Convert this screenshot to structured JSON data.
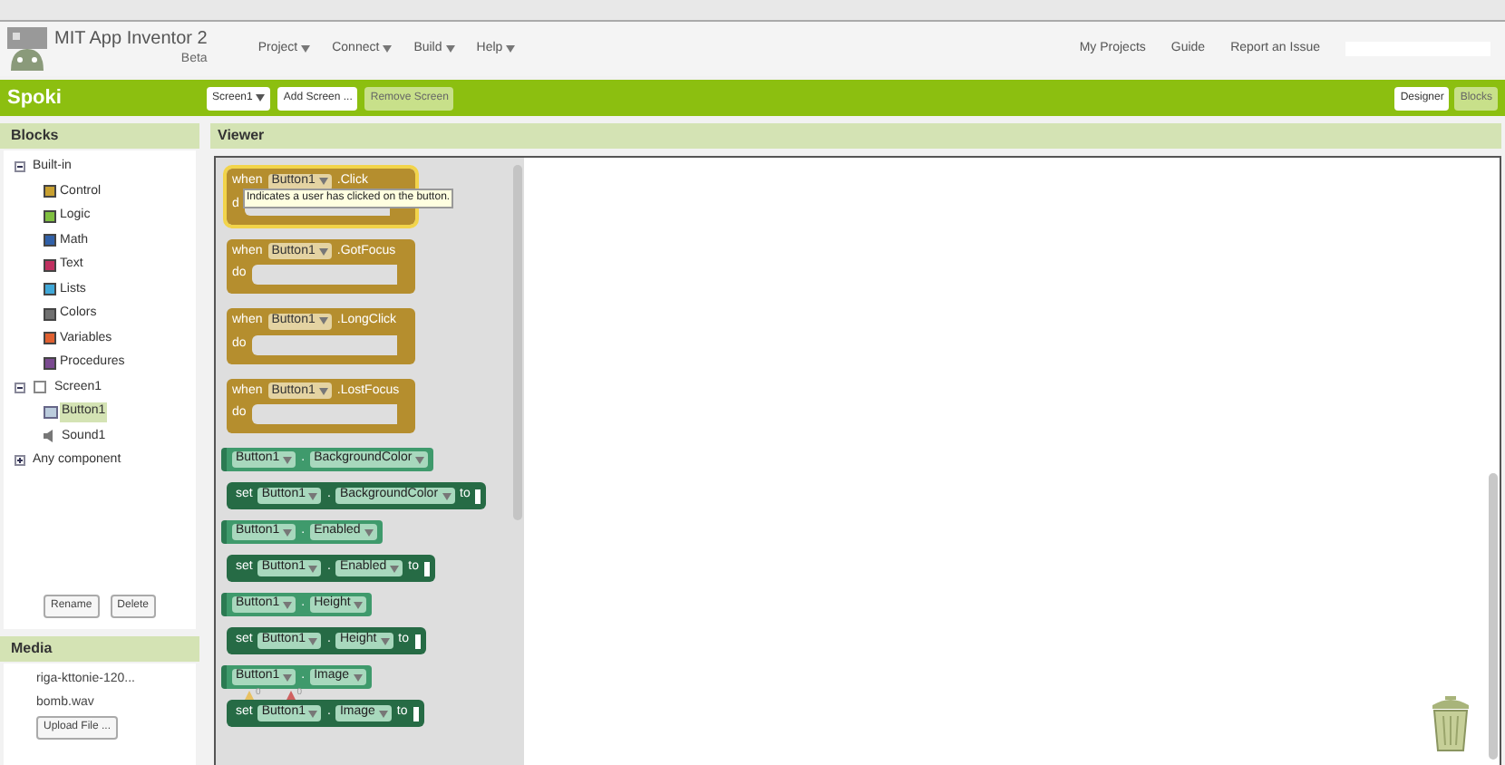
{
  "header": {
    "app_title": "MIT App Inventor 2",
    "subtitle": "Beta",
    "menus": [
      "Project",
      "Connect",
      "Build",
      "Help"
    ],
    "links": [
      "My Projects",
      "Guide",
      "Report an Issue"
    ]
  },
  "toolbar": {
    "project_name": "Spoki",
    "screen": "Screen1",
    "buttons": [
      {
        "label": "Add Screen ...",
        "disabled": false
      },
      {
        "label": "Remove Screen",
        "disabled": true
      }
    ],
    "views": [
      {
        "label": "Designer",
        "selected": false
      },
      {
        "label": "Blocks",
        "selected": true
      }
    ]
  },
  "blocks_panel": {
    "title": "Blocks",
    "tree": [
      {
        "label": "Built-in",
        "expanded": true,
        "selected": false,
        "children": [
          {
            "label": "Control",
            "color": "#c8a030",
            "selected": false
          },
          {
            "label": "Logic",
            "color": "#80c040",
            "selected": false
          },
          {
            "label": "Math",
            "color": "#3060a8",
            "selected": false
          },
          {
            "label": "Text",
            "color": "#c03060",
            "selected": false
          },
          {
            "label": "Lists",
            "color": "#40a8d8",
            "selected": false
          },
          {
            "label": "Colors",
            "color": "#707070",
            "selected": false
          },
          {
            "label": "Variables",
            "color": "#e06030",
            "selected": false
          },
          {
            "label": "Procedures",
            "color": "#7a4a90",
            "selected": false
          }
        ]
      },
      {
        "label": "Screen1",
        "expanded": true,
        "selected": false,
        "children": [
          {
            "label": "Button1",
            "kind": "button",
            "selected": true
          },
          {
            "label": "Sound1",
            "kind": "sound",
            "selected": false
          }
        ]
      },
      {
        "label": "Any component",
        "expanded": false,
        "selected": false
      }
    ],
    "buttons": [
      "Rename",
      "Delete"
    ]
  },
  "media": {
    "title": "Media",
    "files": [
      "riga-kttonie-120...",
      "bomb.wav"
    ],
    "upload": "Upload File ..."
  },
  "viewer": {
    "title": "Viewer",
    "blocks": [
      {
        "kind": "event",
        "when": "when",
        "component": "Button1",
        "event": ".Click",
        "do": "d",
        "selected": true,
        "tooltip": "Indicates a user has clicked on the button."
      },
      {
        "kind": "event",
        "when": "when",
        "component": "Button1",
        "event": ".GotFocus",
        "do": "do",
        "selected": false
      },
      {
        "kind": "event",
        "when": "when",
        "component": "Button1",
        "event": ".LongClick",
        "do": "do",
        "selected": false
      },
      {
        "kind": "event",
        "when": "when",
        "component": "Button1",
        "event": ".LostFocus",
        "do": "do",
        "selected": false
      },
      {
        "kind": "getter",
        "component": "Button1",
        "dot": ".",
        "property": "BackgroundColor"
      },
      {
        "kind": "setter",
        "set": "set",
        "component": "Button1",
        "dot": ".",
        "property": "BackgroundColor",
        "to": "to"
      },
      {
        "kind": "getter",
        "component": "Button1",
        "dot": ".",
        "property": "Enabled"
      },
      {
        "kind": "setter",
        "set": "set",
        "component": "Button1",
        "dot": ".",
        "property": "Enabled",
        "to": "to"
      },
      {
        "kind": "getter",
        "component": "Button1",
        "dot": ".",
        "property": "Height"
      },
      {
        "kind": "setter",
        "set": "set",
        "component": "Button1",
        "dot": ".",
        "property": "Height",
        "to": "to"
      },
      {
        "kind": "getter",
        "component": "Button1",
        "dot": ".",
        "property": "Image",
        "warnings": [
          "0",
          "0"
        ]
      },
      {
        "kind": "setter",
        "set": "set",
        "component": "Button1",
        "dot": ".",
        "property": "Image",
        "to": "to"
      }
    ]
  }
}
